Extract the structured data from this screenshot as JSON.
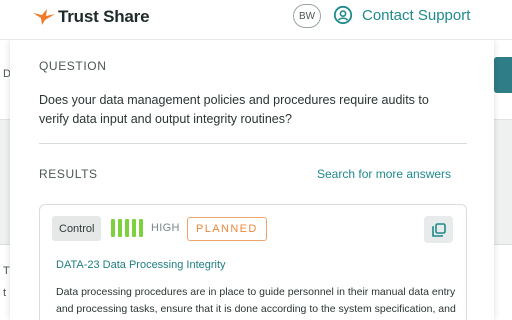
{
  "header": {
    "brand": "Trust Share",
    "user_initials": "BW",
    "support_label": "Contact Support"
  },
  "question": {
    "section_label": "QUESTION",
    "text": "Does your data management policies and procedures require audits to verify data input and output integrity routines?"
  },
  "results": {
    "section_label": "RESULTS",
    "more_link": "Search for more answers",
    "items": [
      {
        "type_tag": "Control",
        "confidence_label": "HIGH",
        "confidence_bars": 5,
        "status": "PLANNED",
        "title": "DATA-23 Data Processing Integrity",
        "description": "Data processing procedures are in place to guide personnel in their manual data entry and processing tasks, ensure that it is done according to the system specification, and that any errors are detected and corrected."
      }
    ]
  },
  "background": {
    "letters": [
      "D",
      "T",
      "t"
    ]
  },
  "colors": {
    "accent": "#1f8a8c",
    "brand_orange": "#f07a2a",
    "confidence_green": "#7dd13f",
    "status_orange": "#e8893f"
  },
  "icons": {
    "brand": "bird-logo-icon",
    "support": "support-agent-icon",
    "copy": "copy-icon"
  }
}
